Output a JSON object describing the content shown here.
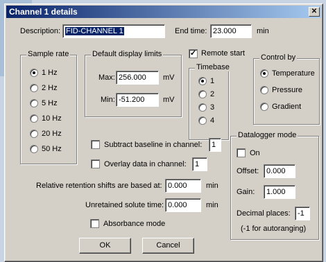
{
  "window": {
    "title": "Channel 1 details",
    "close_glyph": "✕"
  },
  "description": {
    "label": "Description:",
    "value": "FID-CHANNEL 1"
  },
  "end_time": {
    "label": "End time:",
    "value": "23.000",
    "unit": "min"
  },
  "sample_rate": {
    "title": "Sample rate",
    "options": [
      "1 Hz",
      "2 Hz",
      "5 Hz",
      "10 Hz",
      "20 Hz",
      "50 Hz"
    ],
    "selected": "1 Hz"
  },
  "display_limits": {
    "title": "Default display limits",
    "max_label": "Max:",
    "max_value": "256.000",
    "max_unit": "mV",
    "min_label": "Min:",
    "min_value": "-51.200",
    "min_unit": "mV"
  },
  "remote_start": {
    "label": "Remote start",
    "checked": true,
    "check_glyph": "✓"
  },
  "timebase": {
    "title": "Timebase",
    "options": [
      "1",
      "2",
      "3",
      "4"
    ],
    "selected": "1"
  },
  "control_by": {
    "title": "Control by",
    "options": [
      "Temperature",
      "Pressure",
      "Gradient"
    ],
    "selected": "Temperature"
  },
  "subtract_baseline": {
    "label": "Subtract baseline in channel:",
    "value": "1",
    "checked": false
  },
  "overlay_data": {
    "label": "Overlay data in channel:",
    "value": "1",
    "checked": false
  },
  "retention_shift": {
    "label": "Relative retention shifts are based at:",
    "value": "0.000",
    "unit": "min"
  },
  "unretained_time": {
    "label": "Unretained solute time:",
    "value": "0.000",
    "unit": "min"
  },
  "absorbance_mode": {
    "label": "Absorbance mode",
    "checked": false
  },
  "datalogger": {
    "title": "Datalogger mode",
    "on_label": "On",
    "offset_label": "Offset:",
    "offset_value": "0.000",
    "gain_label": "Gain:",
    "gain_value": "1.000",
    "decimal_label": "Decimal places:",
    "decimal_value": "-1",
    "decimal_note": "(-1 for autoranging)"
  },
  "buttons": {
    "ok": "OK",
    "cancel": "Cancel"
  }
}
